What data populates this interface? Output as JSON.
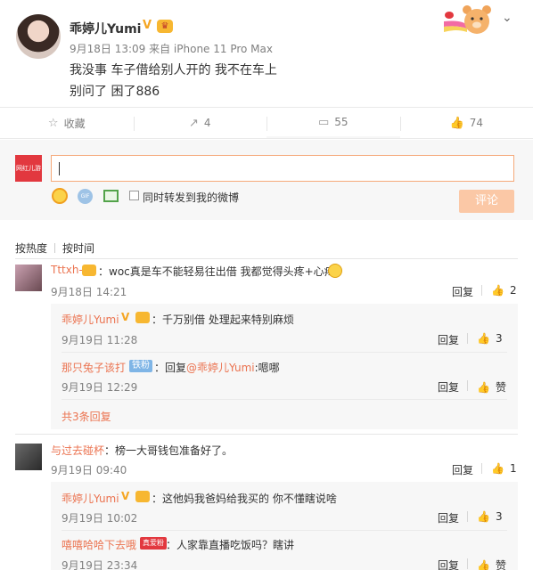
{
  "post": {
    "author": "乖婷儿Yumi",
    "meta": "9月18日 13:09 来自 iPhone 11 Pro Max",
    "line1": "我没事 车子借给别人开的 我不在车上",
    "line2": "别问了 困了886"
  },
  "actions": {
    "favorite_label": "收藏",
    "repost_count": "4",
    "comment_count": "55",
    "like_count": "74"
  },
  "composer": {
    "input_value": "",
    "repost_label": "同时转发到我的微博",
    "submit_label": "评论",
    "avatar_text": "网红儿游"
  },
  "sort": {
    "hot_label": "按热度",
    "time_label": "按时间"
  },
  "comments": [
    {
      "user": "Tttxh-",
      "text": "：woc真是车不能轻易往出借 我都觉得头疼+心疼",
      "time": "9月18日 14:21",
      "reply_label": "回复",
      "likes": "2",
      "replies": [
        {
          "user": "乖婷儿Yumi",
          "text": "：千万别借 处理起来特别麻烦",
          "time": "9月19日 11:28",
          "reply_label": "回复",
          "likes": "3"
        },
        {
          "user": "那只兔子该打",
          "badge": "铁粉",
          "text_prefix": "：回复",
          "mention": "@乖婷儿Yumi",
          "text_suffix": ":嗯哪",
          "time": "9月19日 12:29",
          "reply_label": "回复",
          "likes": "赞"
        }
      ],
      "more_replies": "共3条回复"
    },
    {
      "user": "与过去碰杯",
      "text": "：榜一大哥钱包准备好了。",
      "time": "9月19日 09:40",
      "reply_label": "回复",
      "likes": "1",
      "replies": [
        {
          "user": "乖婷儿Yumi",
          "text": "：这他妈我爸妈给我买的 你不懂瞎说啥",
          "time": "9月19日 10:02",
          "reply_label": "回复",
          "likes": "3"
        },
        {
          "user": "嘻嘻哈哈下去哦",
          "badge": "真爱粉",
          "text": "：人家靠直播吃饭吗？瞎讲",
          "time": "9月19日 23:34",
          "reply_label": "回复",
          "likes": "赞"
        }
      ]
    }
  ],
  "icons": {
    "favorite": "star-icon",
    "repost": "share-icon",
    "comment": "comment-icon",
    "like": "thumb-up-icon",
    "menu": "chevron-down-icon"
  },
  "colors": {
    "accent": "#eb7350",
    "submit_bg": "#fbc8a6",
    "input_border": "#f5a97a",
    "bg_light": "#f7f7f7"
  }
}
